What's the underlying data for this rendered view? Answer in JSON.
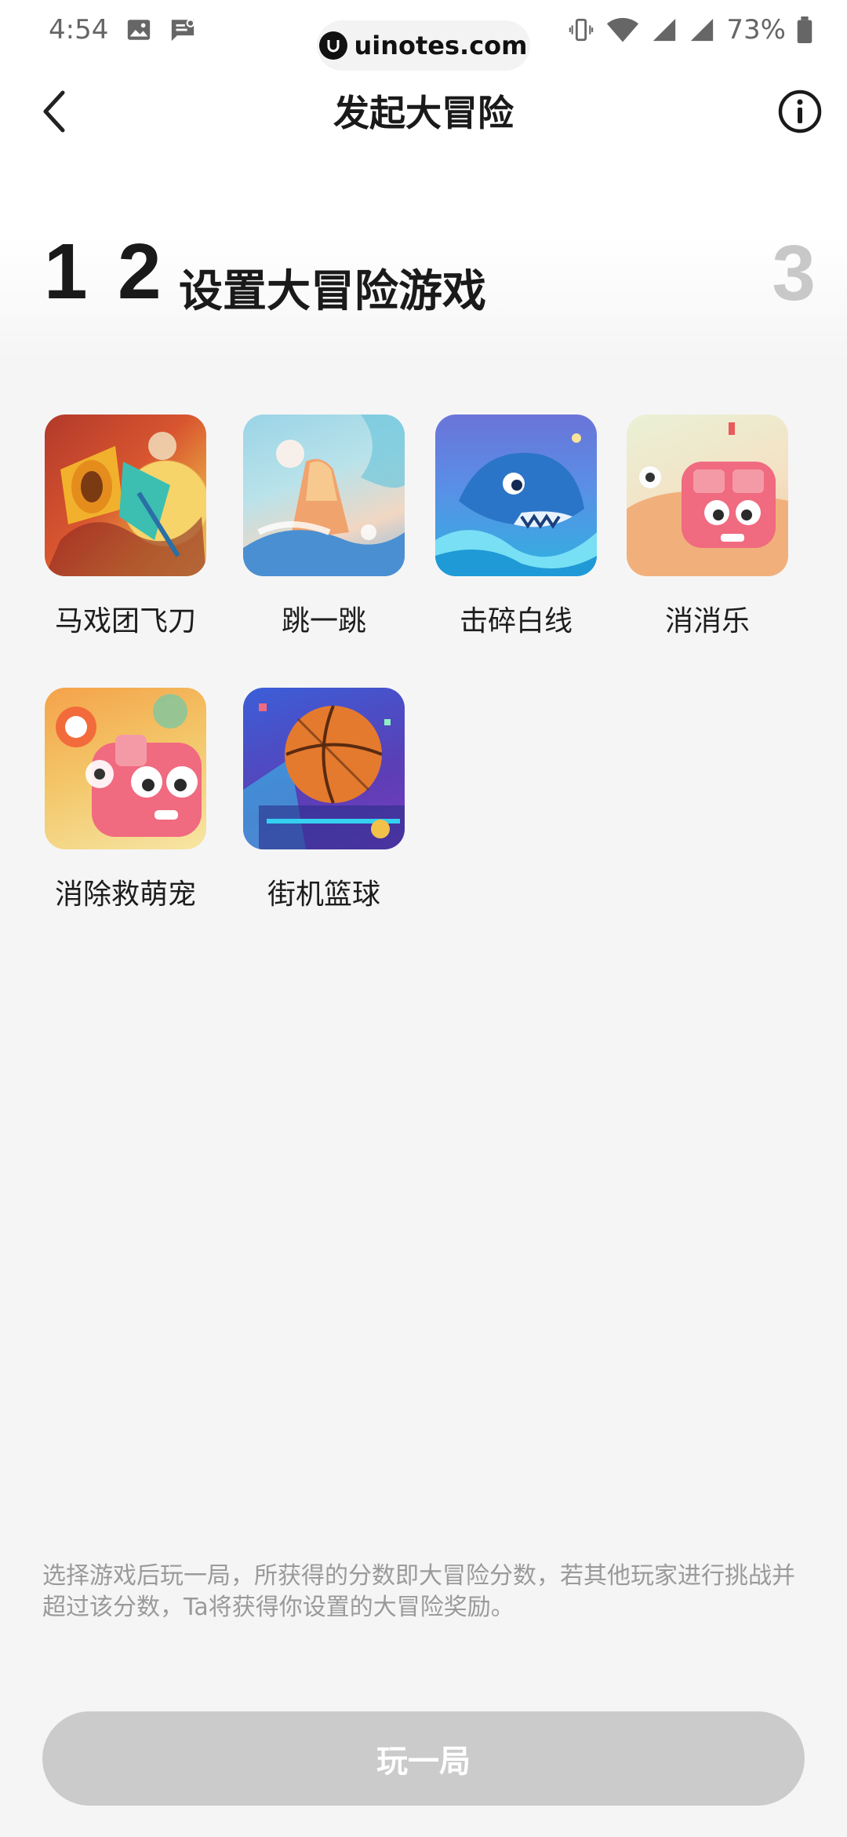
{
  "status_bar": {
    "time": "4:54",
    "battery": "73%",
    "watermark": "uinotes.com"
  },
  "nav": {
    "title": "发起大冒险"
  },
  "steps": {
    "step1": "1",
    "step2": "2",
    "step2_title": "设置大冒险游戏",
    "step3": "3"
  },
  "games": [
    {
      "label": "马戏团飞刀",
      "icon": "circus-knife-game-icon"
    },
    {
      "label": "跳一跳",
      "icon": "jump-game-icon"
    },
    {
      "label": "击碎白线",
      "icon": "shark-game-icon"
    },
    {
      "label": "消消乐",
      "icon": "match-game-icon"
    },
    {
      "label": "消除救萌宠",
      "icon": "pet-rescue-game-icon"
    },
    {
      "label": "街机篮球",
      "icon": "basketball-game-icon"
    }
  ],
  "description": "选择游戏后玩一局，所获得的分数即大冒险分数，若其他玩家进行挑战并超过该分数，Ta将获得你设置的大冒险奖励。",
  "play_button": "玩一局",
  "colors": {
    "button_disabled": "#cbcbcb",
    "step_inactive": "#c8c8c8"
  }
}
